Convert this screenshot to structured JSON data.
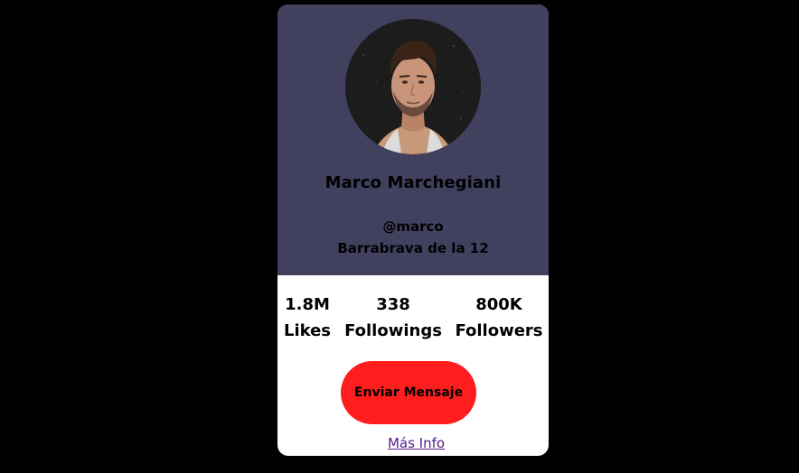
{
  "profile": {
    "name": "Marco Marchegiani",
    "handle": "@marco",
    "bio": "Barrabrava de la 12",
    "avatar_icon": "person-photo"
  },
  "stats": [
    {
      "value": "1.8M",
      "label": "Likes"
    },
    {
      "value": "338",
      "label": "Followings"
    },
    {
      "value": "800K",
      "label": "Followers"
    }
  ],
  "actions": {
    "message_label": "Enviar Mensaje",
    "more_info_label": "Más Info"
  },
  "colors": {
    "page_background": "#000000",
    "card_header": "#41405f",
    "card_body": "#ffffff",
    "button": "#ff1d1d",
    "link": "#551a8b"
  }
}
